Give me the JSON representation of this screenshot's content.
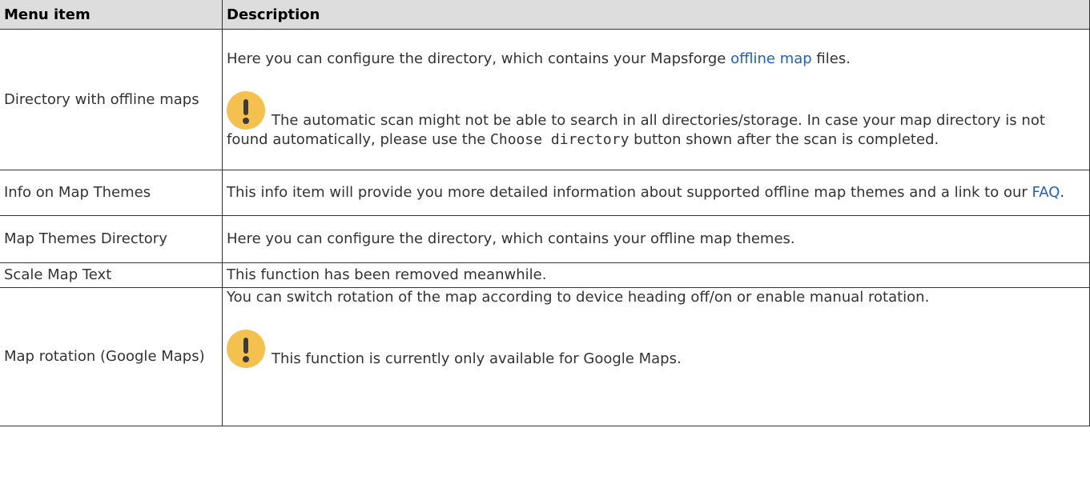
{
  "header": {
    "col1": "Menu item",
    "col2": "Description"
  },
  "rows": [
    {
      "item": "Directory with offline maps",
      "desc_pre": "Here you can configure the directory, which contains your Mapsforge ",
      "desc_link": "offline map",
      "desc_post": " files.",
      "note_pre": "The automatic scan might not be able to search in all directories/storage. In case your map directory is not found automatically, please use the ",
      "note_code": "Choose directory",
      "note_post": " button shown after the scan is completed."
    },
    {
      "item": "Info on Map Themes",
      "desc_pre": "This info item will provide you more detailed information about supported offline map themes and a link to our ",
      "desc_link": "FAQ",
      "desc_post": "."
    },
    {
      "item": "Map Themes Directory",
      "desc": "Here you can configure the directory, which contains your offline map themes."
    },
    {
      "item": "Scale Map Text",
      "desc": "This function has been removed meanwhile."
    },
    {
      "item": "Map rotation (Google Maps)",
      "desc": "You can switch rotation of the map according to device heading off/on or enable manual rotation.",
      "note": "This function is currently only available for Google Maps."
    }
  ],
  "icons": {
    "warning": "exclamation-circle-icon",
    "warning_color": "#f4c04e"
  }
}
